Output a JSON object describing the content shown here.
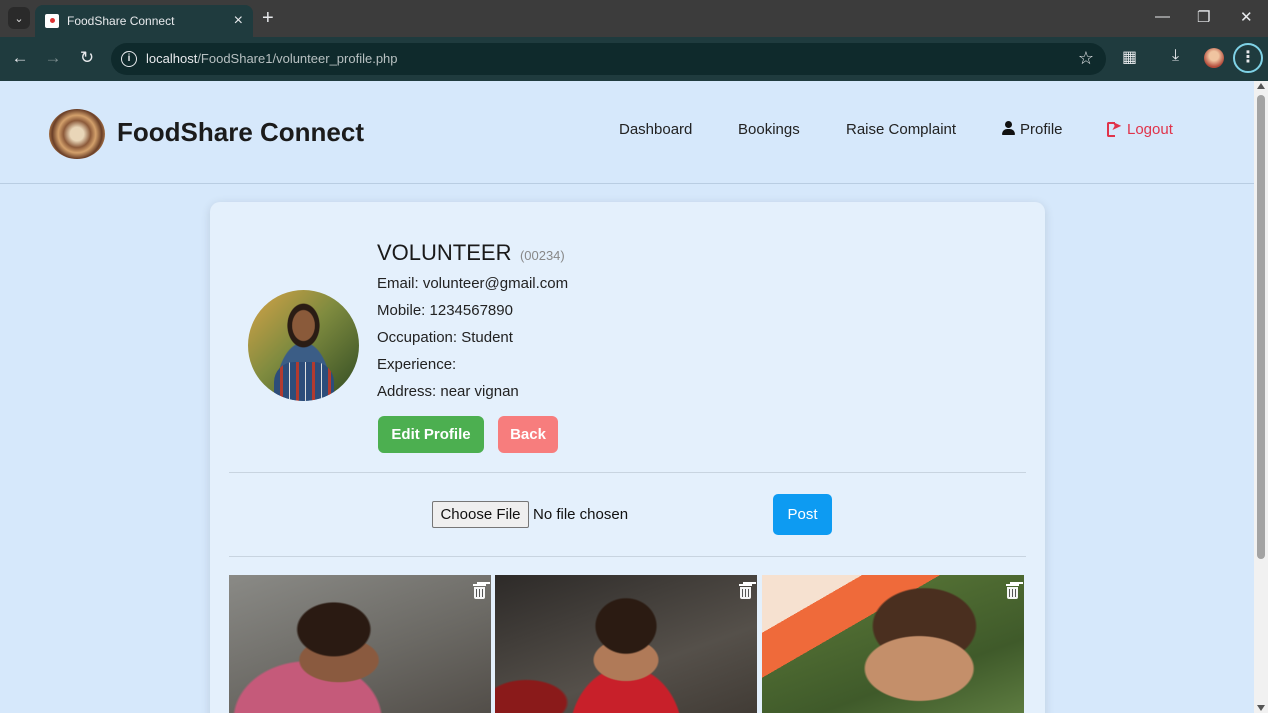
{
  "browser": {
    "tab_title": "FoodShare Connect",
    "url_host": "localhost",
    "url_path": "/FoodShare1/volunteer_profile.php"
  },
  "header": {
    "brand": "FoodShare Connect",
    "nav": {
      "dashboard": "Dashboard",
      "bookings": "Bookings",
      "complaint": "Raise Complaint",
      "profile": "Profile",
      "logout": "Logout"
    }
  },
  "profile": {
    "name": "VOLUNTEER",
    "id": "(00234)",
    "email": "Email: volunteer@gmail.com",
    "mobile": "Mobile: 1234567890",
    "occupation": "Occupation: Student",
    "experience": "Experience:",
    "address": "Address: near vignan",
    "edit_label": "Edit Profile",
    "back_label": "Back"
  },
  "upload": {
    "choose_label": "Choose File",
    "status": "No file chosen",
    "post_label": "Post"
  },
  "colors": {
    "edit": "#4caf50",
    "back": "#f77d7d",
    "post": "#0d9bf2",
    "logout": "#e0334a"
  }
}
